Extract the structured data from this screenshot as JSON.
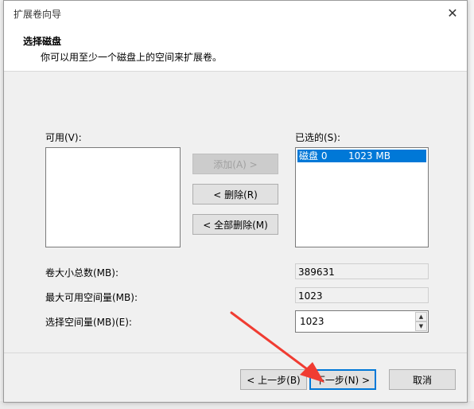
{
  "dialog": {
    "title": "扩展卷向导",
    "close_glyph": "✕",
    "header_title": "选择磁盘",
    "header_subtitle": "你可以用至少一个磁盘上的空间来扩展卷。"
  },
  "available": {
    "label": "可用(V):",
    "items": []
  },
  "selected": {
    "label": "已选的(S):",
    "items": [
      {
        "disk": "磁盘 0",
        "size": "1023 MB"
      }
    ]
  },
  "actions": {
    "add": "添加(A) >",
    "remove": "< 删除(R)",
    "remove_all": "< 全部删除(M)"
  },
  "fields": {
    "total_label": "卷大小总数(MB):",
    "total_value": "389631",
    "max_label": "最大可用空间量(MB):",
    "max_value": "1023",
    "select_label": "选择空间量(MB)(E):",
    "select_value": "1023"
  },
  "nav": {
    "back": "< 上一步(B)",
    "next": "下一步(N) >",
    "cancel": "取消"
  },
  "colors": {
    "selection": "#0078d7",
    "annotation_arrow": "#f03c32"
  }
}
